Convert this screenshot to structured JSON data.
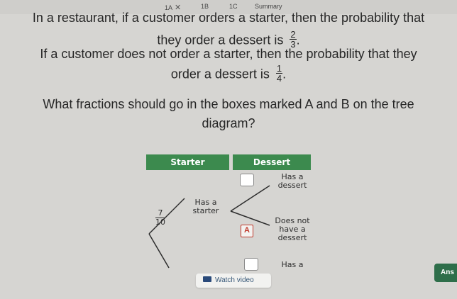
{
  "tabs": {
    "tab_1a": "1A",
    "tab_1b": "1B",
    "tab_1c": "1C",
    "tab_summary": "Summary"
  },
  "question": {
    "line1": "In a restaurant, if a customer orders a starter, then the probability that",
    "line2_text": "they order a dessert is",
    "line2_frac": {
      "num": "2",
      "den": "3"
    },
    "line3": "If a customer does not order a starter, then the probability that they",
    "line4_text": "order a dessert is",
    "line4_frac": {
      "num": "1",
      "den": "4"
    },
    "line5": "What fractions should go in the boxes marked A and B on the tree",
    "line6": "diagram?"
  },
  "tree": {
    "header_starter": "Starter",
    "header_dessert": "Dessert",
    "has_starter": "Has a starter",
    "given_prob": {
      "num": "7",
      "den": "10"
    },
    "has_dessert": "Has a dessert",
    "no_dessert": "Does not have a dessert",
    "box_a_label": "A",
    "has_dessert_2": "Has a"
  },
  "watch_video": "Watch video",
  "answer_tab": "Ans",
  "colors": {
    "header_green": "#3c8a4e",
    "box_a_red": "#c0392b",
    "answer_green": "#2e6e4a"
  }
}
